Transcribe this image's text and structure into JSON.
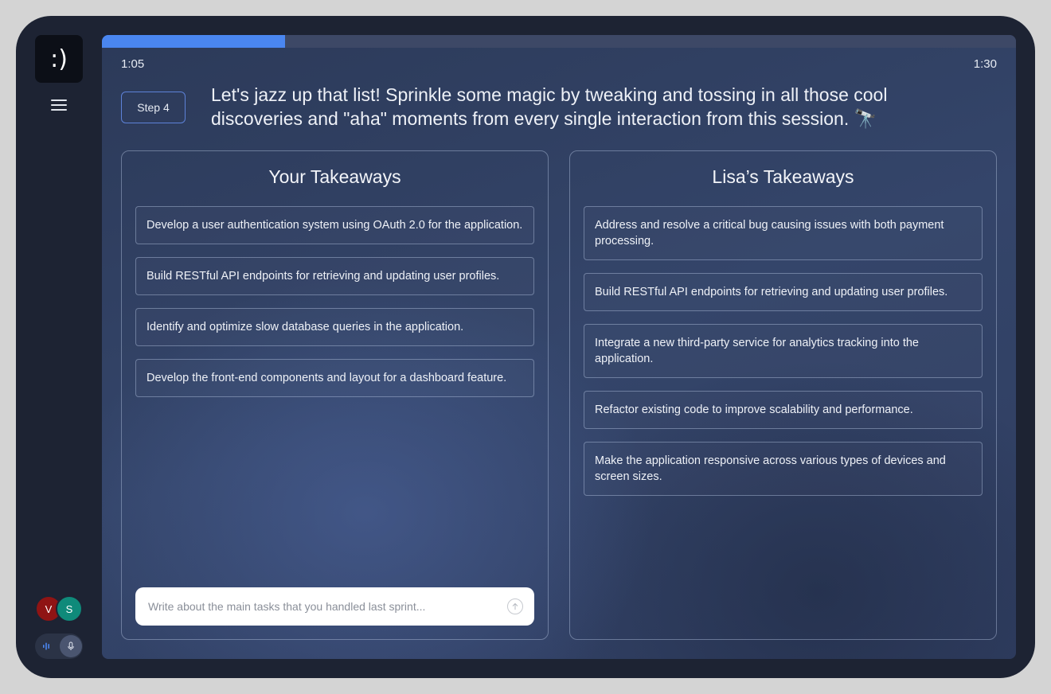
{
  "sidebar": {
    "logo_text": ":)",
    "menu_icon": "hamburger-menu-icon",
    "participants": [
      {
        "initial": "V",
        "color": "#8f1414"
      },
      {
        "initial": "S",
        "color": "#0f8a7a"
      }
    ],
    "audio": {
      "wave_icon": "audio-wave-icon",
      "mic_icon": "microphone-icon"
    }
  },
  "session": {
    "progress_fraction": 0.2,
    "elapsed": "1:05",
    "total": "1:30"
  },
  "step": {
    "badge": "Step 4",
    "instruction": "Let's jazz up that list! Sprinkle some magic by tweaking and tossing in all those cool discoveries and \"aha\" moments from every single interaction from this session. 🔭"
  },
  "your_takeaways": {
    "title": "Your Takeaways",
    "items": [
      "Develop a user authentication system using OAuth 2.0 for the application.",
      "Build RESTful API endpoints for retrieving and updating user profiles.",
      "Identify and optimize slow database queries in the application.",
      "Develop the front-end components and layout for a dashboard feature."
    ],
    "input_placeholder": "Write about the main tasks that you handled last sprint...",
    "send_icon": "send-arrow-icon"
  },
  "lisa_takeaways": {
    "title": "Lisa’s Takeaways",
    "items": [
      "Address and resolve a critical bug causing issues with both payment processing.",
      "Build RESTful API endpoints for retrieving and updating user profiles.",
      "Integrate a new third-party service for analytics tracking into the application.",
      "Refactor existing code to improve scalability and performance.",
      "Make the application responsive across various types of devices and screen sizes."
    ]
  },
  "colors": {
    "accent": "#4a86f0",
    "frame": "#1d2333",
    "outer": "#d4d4d4"
  }
}
